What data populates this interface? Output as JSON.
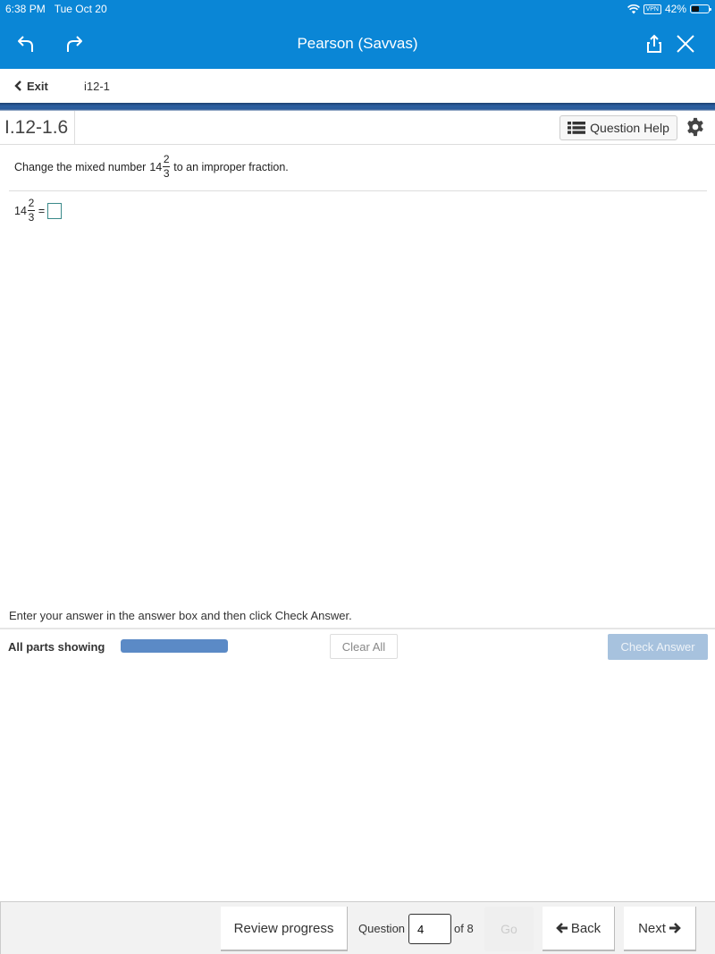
{
  "status_bar": {
    "time": "6:38 PM",
    "date": "Tue Oct 20",
    "vpn": "VPN",
    "battery": "42%",
    "battery_level": 0.42
  },
  "app_bar": {
    "title": "Pearson (Savvas)",
    "icons": [
      "undo-icon",
      "redo-icon",
      "share-icon",
      "close-icon"
    ]
  },
  "nav": {
    "exit_label": "Exit",
    "breadcrumb": "i12-1"
  },
  "question_header": {
    "id": "I.12-1.6",
    "help_label": "Question Help"
  },
  "question": {
    "prompt_before": "Change the mixed number",
    "whole": "14",
    "numerator": "2",
    "denominator": "3",
    "prompt_after": "to an improper fraction.",
    "equals": "=",
    "answer_value": ""
  },
  "controls": {
    "instruction": "Enter your answer in the answer box and then click Check Answer.",
    "all_parts_label": "All parts showing",
    "progress": 1.0,
    "clear_all_label": "Clear All",
    "check_answer_label": "Check Answer"
  },
  "footer": {
    "review_label": "Review progress",
    "question_label": "Question",
    "question_number": "4",
    "of_label": "of 8",
    "go_label": "Go",
    "back_label": "Back",
    "next_label": "Next"
  }
}
